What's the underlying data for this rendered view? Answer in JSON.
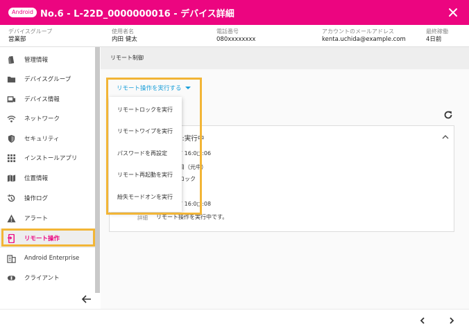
{
  "header": {
    "os_badge": "Android",
    "title": "No.6 - L-22D_0000000016 - デバイス詳細",
    "close_icon": "close-icon"
  },
  "info": [
    {
      "label": "デバイスグループ",
      "value": "営業部"
    },
    {
      "label": "使用者名",
      "value": "内田 健太"
    },
    {
      "label": "電話番号",
      "value": "080xxxxxxxx"
    },
    {
      "label": "アカウントのメールアドレス",
      "value": "kenta.uchida@example.com"
    },
    {
      "label": "最終稼働",
      "value": "4日前"
    }
  ],
  "sidebar": {
    "items": [
      {
        "label": "管理情報",
        "icon": "clipboard-icon"
      },
      {
        "label": "デバイスグループ",
        "icon": "folder-icon"
      },
      {
        "label": "デバイス情報",
        "icon": "devices-icon"
      },
      {
        "label": "ネットワーク",
        "icon": "wifi-icon"
      },
      {
        "label": "セキュリティ",
        "icon": "shield-icon"
      },
      {
        "label": "インストールアプリ",
        "icon": "apps-grid-icon"
      },
      {
        "label": "位置情報",
        "icon": "map-icon"
      },
      {
        "label": "操作ログ",
        "icon": "history-icon"
      },
      {
        "label": "アラート",
        "icon": "warning-icon"
      },
      {
        "label": "リモート操作",
        "icon": "remote-device-icon",
        "active": true
      },
      {
        "label": "Android Enterprise",
        "icon": "building-icon"
      },
      {
        "label": "クライアント",
        "icon": "client-icon"
      }
    ],
    "back_icon": "arrow-left-icon"
  },
  "content": {
    "section_title": "リモート制御",
    "dropdown_label": "リモート操作を実行する",
    "card": {
      "title": "ヮ:実行中",
      "lines": [
        "7 16:0□:06",
        "目（元中）",
        "ロック",
        "7 16:0□:08"
      ],
      "detail_label": "詳細",
      "detail_value": "リモート操作を実行中です。"
    }
  },
  "menu": {
    "items": [
      "リモートロックを実行",
      "リモートワイプを実行",
      "パスワードを再設定",
      "リモート再起動を実行",
      "紛失モードオンを実行"
    ]
  },
  "colors": {
    "brand": "#ec0580",
    "accent": "#1a9fd9",
    "highlight": "#f2b536"
  }
}
